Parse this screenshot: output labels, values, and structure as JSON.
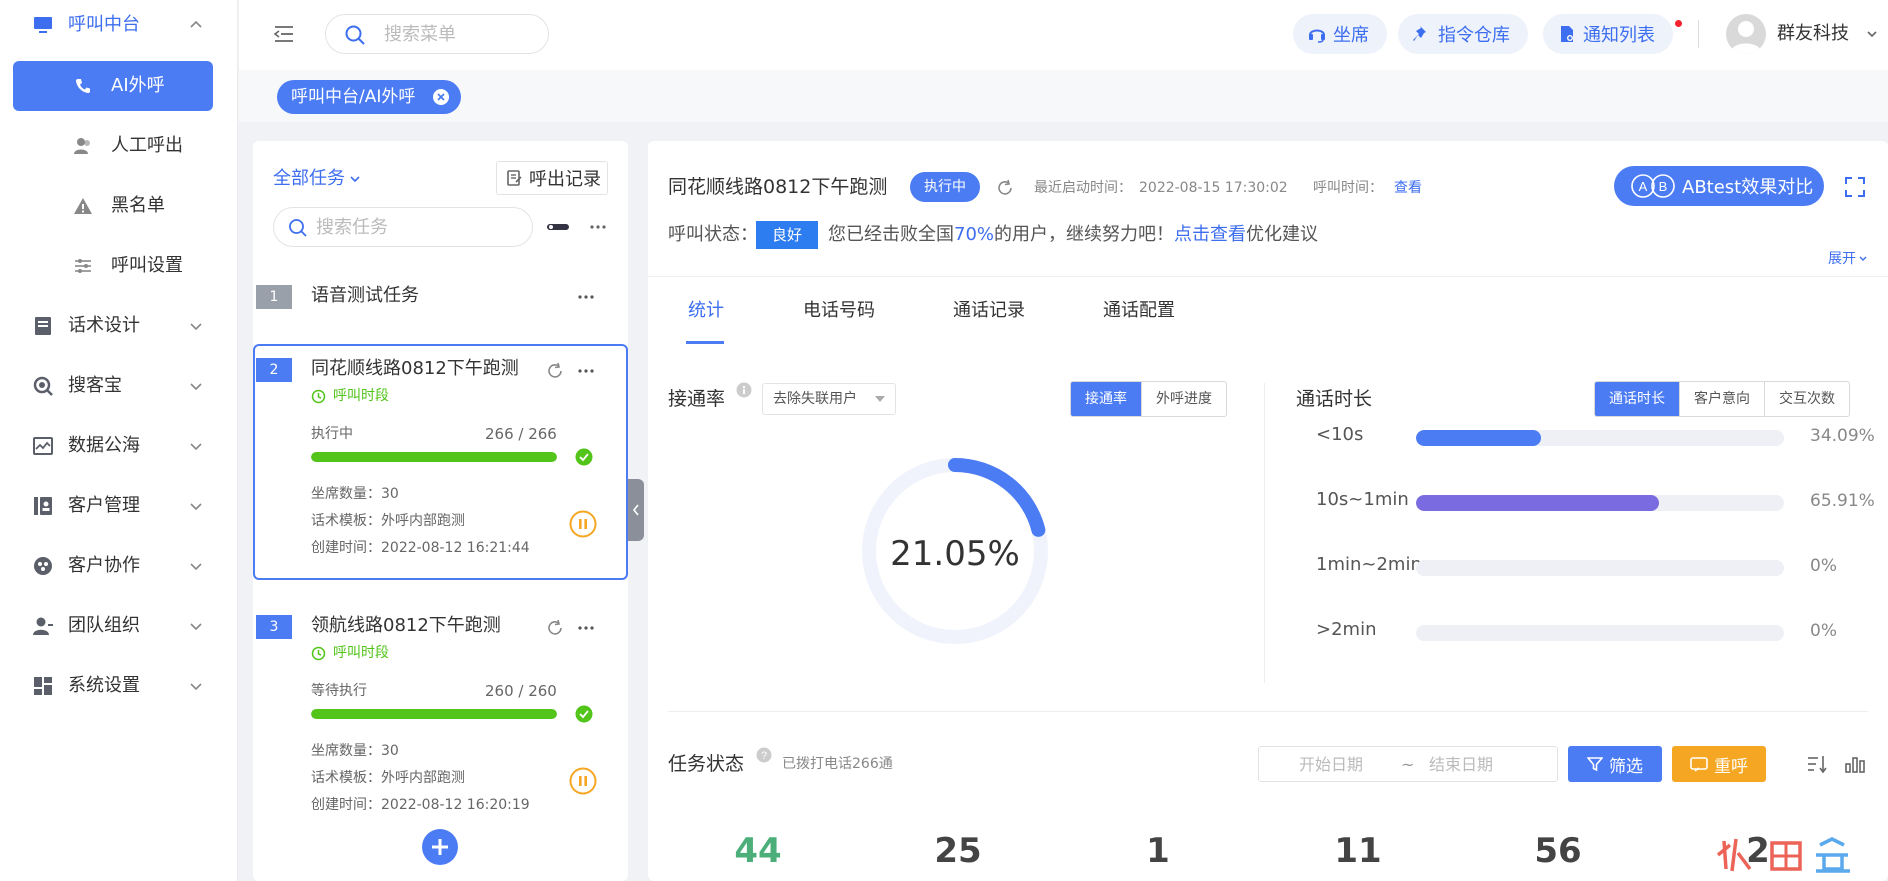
{
  "sidebar": {
    "items": [
      {
        "label": "呼叫中台",
        "active": true
      },
      {
        "label": "话术设计"
      },
      {
        "label": "搜客宝"
      },
      {
        "label": "数据公海"
      },
      {
        "label": "客户管理"
      },
      {
        "label": "客户协作"
      },
      {
        "label": "团队组织"
      },
      {
        "label": "系统设置"
      }
    ],
    "sub_items": [
      {
        "label": "AI外呼",
        "active": true
      },
      {
        "label": "人工呼出"
      },
      {
        "label": "黑名单"
      },
      {
        "label": "呼叫设置"
      }
    ]
  },
  "topbar": {
    "search_placeholder": "搜索菜单",
    "buttons": {
      "seat": "坐席",
      "command": "指令仓库",
      "notify": "通知列表"
    },
    "user_name": "群友科技"
  },
  "breadcrumb_tag": "呼叫中台/AI外呼",
  "task_panel": {
    "filter_label": "全部任务",
    "record_button": "呼出记录",
    "search_placeholder": "搜索任务",
    "tasks": [
      {
        "index": "1",
        "name": "语音测试任务"
      },
      {
        "index": "2",
        "name": "同花顺线路0812下午跑测",
        "period": "呼叫时段",
        "status": "执行中",
        "progress_text": "266 / 266",
        "progress": 1.0,
        "seat_count": "坐席数量：30",
        "template": "话术模板：外呼内部跑测",
        "created": "创建时间：2022-08-12 16:21:44"
      },
      {
        "index": "3",
        "name": "领航线路0812下午跑测",
        "period": "呼叫时段",
        "status": "等待执行",
        "progress_text": "260 / 260",
        "progress": 1.0,
        "seat_count": "坐席数量：30",
        "template": "话术模板：外呼内部跑测",
        "created": "创建时间：2022-08-12 16:20:19"
      }
    ]
  },
  "detail": {
    "title": "同花顺线路0812下午跑测",
    "status_badge": "执行中",
    "last_start_label": "最近启动时间：",
    "last_start_value": "2022-08-15 17:30:02",
    "call_time_label": "呼叫时间：",
    "call_time_link": "查看",
    "abtest_button": "ABtest效果对比",
    "call_status_label": "呼叫状态：",
    "call_status_badge": "良好",
    "call_status_text_1": "您已经击败全国",
    "call_status_percent": "70%",
    "call_status_text_2": "的用户，继续努力吧！",
    "call_status_link": "点击查看",
    "call_status_text_3": "优化建议",
    "expand_label": "展开",
    "tabs": [
      "统计",
      "电话号码",
      "通话记录",
      "通话配置"
    ],
    "connect": {
      "title": "接通率",
      "select": "去除失联用户",
      "seg": [
        "接通率",
        "外呼进度"
      ],
      "value": "21.05%",
      "fraction": 0.2105
    },
    "duration": {
      "title": "通话时长",
      "seg": [
        "通话时长",
        "客户意向",
        "交互次数"
      ],
      "rows": [
        {
          "label": "<10s",
          "pct_text": "34.09%",
          "value": 0.3409,
          "color": "#4b7cf3"
        },
        {
          "label": "10s~1min",
          "pct_text": "65.91%",
          "value": 0.6591,
          "color": "#7b6be0"
        },
        {
          "label": "1min~2min",
          "pct_text": "0%",
          "value": 0
        },
        {
          "label": ">2min",
          "pct_text": "0%",
          "value": 0
        }
      ]
    },
    "task_status": {
      "title": "任务状态",
      "dialed": "已拨打电话266通",
      "start_placeholder": "开始日期",
      "range_sep": "~",
      "end_placeholder": "结束日期",
      "filter_button": "筛选",
      "redial_button": "重呼",
      "numbers": [
        "44",
        "25",
        "1",
        "11",
        "56",
        "2"
      ]
    }
  },
  "colors": {
    "primary": "#4b7cf3",
    "success": "#52c41a",
    "warning": "#f5a623",
    "number_green": "#4caf7a"
  }
}
